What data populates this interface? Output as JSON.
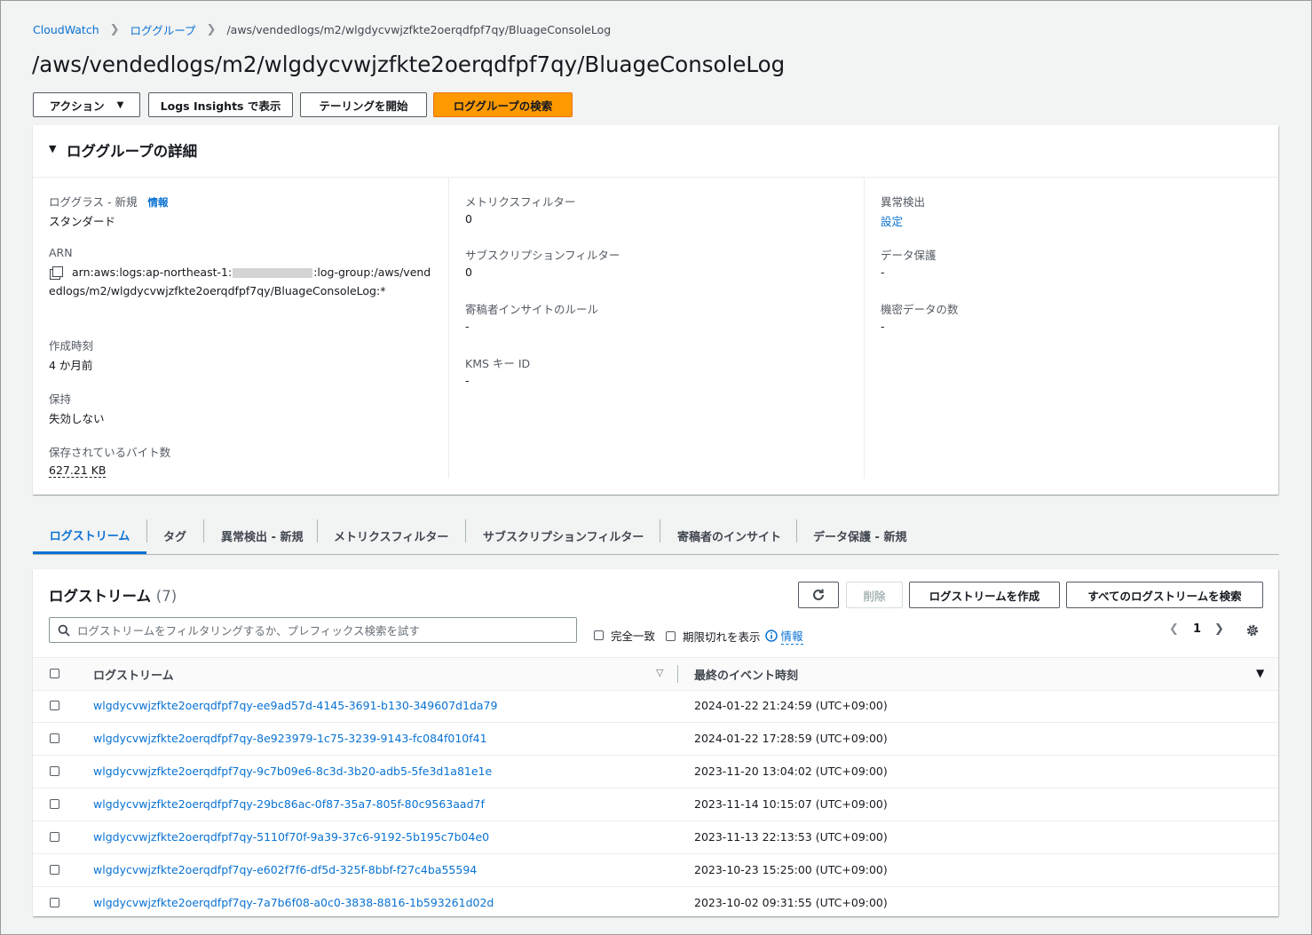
{
  "breadcrumb": {
    "items": [
      "CloudWatch",
      "ロググループ"
    ],
    "current": "/aws/vendedlogs/m2/wlgdycvwjzfkte2oerqdfpf7qy/BluageConsoleLog"
  },
  "page_title": "/aws/vendedlogs/m2/wlgdycvwjzfkte2oerqdfpf7qy/BluageConsoleLog",
  "actions": {
    "action_label": "アクション",
    "logs_insights_label": "Logs Insights で表示",
    "tailing_label": "テーリングを開始",
    "search_label": "ロググループの検索"
  },
  "details": {
    "title": "ロググループの詳細",
    "log_class_label": "ロググラス - 新規",
    "info_label": "情報",
    "log_class_value": "スタンダード",
    "arn_label": "ARN",
    "arn_part1": "arn:aws:logs:ap-northeast-1:",
    "arn_part2": ":log-group:/aws/vendedlogs/m2/wlgdycvwjzfkte2oerqdfpf7qy/BluageConsoleLog:*",
    "created_label": "作成時刻",
    "created_value": "4 か月前",
    "retention_label": "保持",
    "retention_value": "失効しない",
    "stored_bytes_label": "保存されているバイト数",
    "stored_bytes_value": "627.21 KB",
    "metric_filter_label": "メトリクスフィルター",
    "metric_filter_value": "0",
    "subscription_label": "サブスクリプションフィルター",
    "subscription_value": "0",
    "contributor_label": "寄稿者インサイトのルール",
    "contributor_value": "-",
    "kms_label": "KMS キー ID",
    "kms_value": "-",
    "anomaly_label": "異常検出",
    "anomaly_value": "設定",
    "data_protection_label": "データ保護",
    "data_protection_value": "-",
    "sensitive_label": "機密データの数",
    "sensitive_value": "-"
  },
  "tabs": [
    "ログストリーム",
    "タグ",
    "異常検出 - 新規",
    "メトリクスフィルター",
    "サブスクリプションフィルター",
    "寄稿者のインサイト",
    "データ保護 - 新規"
  ],
  "streams": {
    "title": "ログストリーム",
    "count": "(7)",
    "delete_label": "削除",
    "create_label": "ログストリームを作成",
    "search_all_label": "すべてのログストリームを検索",
    "filter_placeholder": "ログストリームをフィルタリングするか、プレフィックス検索を試す",
    "exact_match_label": "完全一致",
    "show_expired_label": "期限切れを表示",
    "info_label": "情報",
    "page": "1",
    "col_stream": "ログストリーム",
    "col_last_event": "最終のイベント時刻",
    "rows": [
      {
        "name": "wlgdycvwjzfkte2oerqdfpf7qy-ee9ad57d-4145-3691-b130-349607d1da79",
        "time": "2024-01-22 21:24:59 (UTC+09:00)"
      },
      {
        "name": "wlgdycvwjzfkte2oerqdfpf7qy-8e923979-1c75-3239-9143-fc084f010f41",
        "time": "2024-01-22 17:28:59 (UTC+09:00)"
      },
      {
        "name": "wlgdycvwjzfkte2oerqdfpf7qy-9c7b09e6-8c3d-3b20-adb5-5fe3d1a81e1e",
        "time": "2023-11-20 13:04:02 (UTC+09:00)"
      },
      {
        "name": "wlgdycvwjzfkte2oerqdfpf7qy-29bc86ac-0f87-35a7-805f-80c9563aad7f",
        "time": "2023-11-14 10:15:07 (UTC+09:00)"
      },
      {
        "name": "wlgdycvwjzfkte2oerqdfpf7qy-5110f70f-9a39-37c6-9192-5b195c7b04e0",
        "time": "2023-11-13 22:13:53 (UTC+09:00)"
      },
      {
        "name": "wlgdycvwjzfkte2oerqdfpf7qy-e602f7f6-df5d-325f-8bbf-f27c4ba55594",
        "time": "2023-10-23 15:25:00 (UTC+09:00)"
      },
      {
        "name": "wlgdycvwjzfkte2oerqdfpf7qy-7a7b6f08-a0c0-3838-8816-1b593261d02d",
        "time": "2023-10-02 09:31:55 (UTC+09:00)"
      }
    ]
  },
  "colors": {
    "accent": "#0972d3",
    "primary_button": "#ff9900"
  }
}
